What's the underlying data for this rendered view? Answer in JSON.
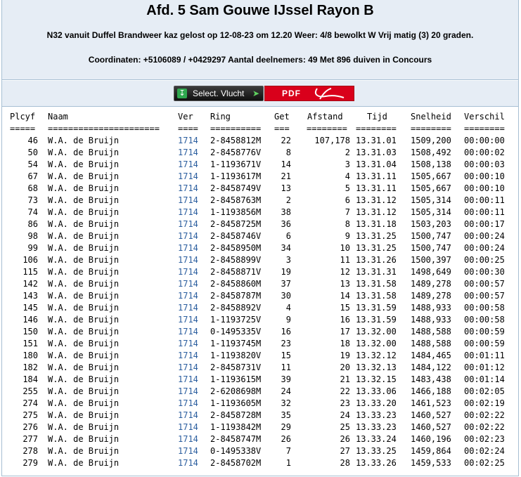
{
  "header": {
    "title": "Afd. 5 Sam Gouwe IJssel Rayon B",
    "line1": "N32 vanuit Duffel Brandweer kaz gelost op 12-08-23 om 12.20 Weer: 4/8 bewolkt W Vrij matig (3) 20 graden.",
    "line2": "Coordinaten: +5106089 / +0429297 Aantal deelnemers: 49 Met 896 duiven in Concours"
  },
  "toolbar": {
    "select_label": "Select. Vlucht",
    "pdf_label": "PDF"
  },
  "columns": {
    "plcyf": "Plcyf",
    "naam": "Naam",
    "ver": "Ver",
    "ring": "Ring",
    "get": "Get",
    "afstand": "Afstand",
    "tijd": "Tijd",
    "snelheid": "Snelheid",
    "verschil": "Verschil"
  },
  "separators": {
    "plcyf": "=====",
    "naam": "======================",
    "ver": "====",
    "ring": "==========",
    "get": "===",
    "afstand": "========",
    "tijd": "========",
    "snelheid": "========",
    "verschil": "========"
  },
  "rows": [
    {
      "plcyf": "46",
      "naam": "W.A. de Bruijn",
      "ver": "1714",
      "ring": "2-8458812M",
      "get": "22",
      "afstand": "107,178",
      "tijd": "13.31.01",
      "snelheid": "1509,200",
      "verschil": "00:00:00"
    },
    {
      "plcyf": "50",
      "naam": "W.A. de Bruijn",
      "ver": "1714",
      "ring": "2-8458776V",
      "get": "8",
      "afstand": "2",
      "tijd": "13.31.03",
      "snelheid": "1508,492",
      "verschil": "00:00:02"
    },
    {
      "plcyf": "54",
      "naam": "W.A. de Bruijn",
      "ver": "1714",
      "ring": "1-1193671V",
      "get": "14",
      "afstand": "3",
      "tijd": "13.31.04",
      "snelheid": "1508,138",
      "verschil": "00:00:03"
    },
    {
      "plcyf": "67",
      "naam": "W.A. de Bruijn",
      "ver": "1714",
      "ring": "1-1193617M",
      "get": "21",
      "afstand": "4",
      "tijd": "13.31.11",
      "snelheid": "1505,667",
      "verschil": "00:00:10"
    },
    {
      "plcyf": "68",
      "naam": "W.A. de Bruijn",
      "ver": "1714",
      "ring": "2-8458749V",
      "get": "13",
      "afstand": "5",
      "tijd": "13.31.11",
      "snelheid": "1505,667",
      "verschil": "00:00:10"
    },
    {
      "plcyf": "73",
      "naam": "W.A. de Bruijn",
      "ver": "1714",
      "ring": "2-8458763M",
      "get": "2",
      "afstand": "6",
      "tijd": "13.31.12",
      "snelheid": "1505,314",
      "verschil": "00:00:11"
    },
    {
      "plcyf": "74",
      "naam": "W.A. de Bruijn",
      "ver": "1714",
      "ring": "1-1193856M",
      "get": "38",
      "afstand": "7",
      "tijd": "13.31.12",
      "snelheid": "1505,314",
      "verschil": "00:00:11"
    },
    {
      "plcyf": "86",
      "naam": "W.A. de Bruijn",
      "ver": "1714",
      "ring": "2-8458725M",
      "get": "36",
      "afstand": "8",
      "tijd": "13.31.18",
      "snelheid": "1503,203",
      "verschil": "00:00:17"
    },
    {
      "plcyf": "98",
      "naam": "W.A. de Bruijn",
      "ver": "1714",
      "ring": "2-8458746V",
      "get": "6",
      "afstand": "9",
      "tijd": "13.31.25",
      "snelheid": "1500,747",
      "verschil": "00:00:24"
    },
    {
      "plcyf": "99",
      "naam": "W.A. de Bruijn",
      "ver": "1714",
      "ring": "2-8458950M",
      "get": "34",
      "afstand": "10",
      "tijd": "13.31.25",
      "snelheid": "1500,747",
      "verschil": "00:00:24"
    },
    {
      "plcyf": "106",
      "naam": "W.A. de Bruijn",
      "ver": "1714",
      "ring": "2-8458899V",
      "get": "3",
      "afstand": "11",
      "tijd": "13.31.26",
      "snelheid": "1500,397",
      "verschil": "00:00:25"
    },
    {
      "plcyf": "115",
      "naam": "W.A. de Bruijn",
      "ver": "1714",
      "ring": "2-8458871V",
      "get": "19",
      "afstand": "12",
      "tijd": "13.31.31",
      "snelheid": "1498,649",
      "verschil": "00:00:30"
    },
    {
      "plcyf": "142",
      "naam": "W.A. de Bruijn",
      "ver": "1714",
      "ring": "2-8458860M",
      "get": "37",
      "afstand": "13",
      "tijd": "13.31.58",
      "snelheid": "1489,278",
      "verschil": "00:00:57"
    },
    {
      "plcyf": "143",
      "naam": "W.A. de Bruijn",
      "ver": "1714",
      "ring": "2-8458787M",
      "get": "30",
      "afstand": "14",
      "tijd": "13.31.58",
      "snelheid": "1489,278",
      "verschil": "00:00:57"
    },
    {
      "plcyf": "145",
      "naam": "W.A. de Bruijn",
      "ver": "1714",
      "ring": "2-8458892V",
      "get": "4",
      "afstand": "15",
      "tijd": "13.31.59",
      "snelheid": "1488,933",
      "verschil": "00:00:58"
    },
    {
      "plcyf": "146",
      "naam": "W.A. de Bruijn",
      "ver": "1714",
      "ring": "1-1193725V",
      "get": "9",
      "afstand": "16",
      "tijd": "13.31.59",
      "snelheid": "1488,933",
      "verschil": "00:00:58"
    },
    {
      "plcyf": "150",
      "naam": "W.A. de Bruijn",
      "ver": "1714",
      "ring": "0-1495335V",
      "get": "16",
      "afstand": "17",
      "tijd": "13.32.00",
      "snelheid": "1488,588",
      "verschil": "00:00:59"
    },
    {
      "plcyf": "151",
      "naam": "W.A. de Bruijn",
      "ver": "1714",
      "ring": "1-1193745M",
      "get": "23",
      "afstand": "18",
      "tijd": "13.32.00",
      "snelheid": "1488,588",
      "verschil": "00:00:59"
    },
    {
      "plcyf": "180",
      "naam": "W.A. de Bruijn",
      "ver": "1714",
      "ring": "1-1193820V",
      "get": "15",
      "afstand": "19",
      "tijd": "13.32.12",
      "snelheid": "1484,465",
      "verschil": "00:01:11"
    },
    {
      "plcyf": "182",
      "naam": "W.A. de Bruijn",
      "ver": "1714",
      "ring": "2-8458731V",
      "get": "11",
      "afstand": "20",
      "tijd": "13.32.13",
      "snelheid": "1484,122",
      "verschil": "00:01:12"
    },
    {
      "plcyf": "184",
      "naam": "W.A. de Bruijn",
      "ver": "1714",
      "ring": "1-1193615M",
      "get": "39",
      "afstand": "21",
      "tijd": "13.32.15",
      "snelheid": "1483,438",
      "verschil": "00:01:14"
    },
    {
      "plcyf": "255",
      "naam": "W.A. de Bruijn",
      "ver": "1714",
      "ring": "2-6208698M",
      "get": "24",
      "afstand": "22",
      "tijd": "13.33.06",
      "snelheid": "1466,188",
      "verschil": "00:02:05"
    },
    {
      "plcyf": "274",
      "naam": "W.A. de Bruijn",
      "ver": "1714",
      "ring": "1-1193605M",
      "get": "32",
      "afstand": "23",
      "tijd": "13.33.20",
      "snelheid": "1461,523",
      "verschil": "00:02:19"
    },
    {
      "plcyf": "275",
      "naam": "W.A. de Bruijn",
      "ver": "1714",
      "ring": "2-8458728M",
      "get": "35",
      "afstand": "24",
      "tijd": "13.33.23",
      "snelheid": "1460,527",
      "verschil": "00:02:22"
    },
    {
      "plcyf": "276",
      "naam": "W.A. de Bruijn",
      "ver": "1714",
      "ring": "1-1193842M",
      "get": "29",
      "afstand": "25",
      "tijd": "13.33.23",
      "snelheid": "1460,527",
      "verschil": "00:02:22"
    },
    {
      "plcyf": "277",
      "naam": "W.A. de Bruijn",
      "ver": "1714",
      "ring": "2-8458747M",
      "get": "26",
      "afstand": "26",
      "tijd": "13.33.24",
      "snelheid": "1460,196",
      "verschil": "00:02:23"
    },
    {
      "plcyf": "278",
      "naam": "W.A. de Bruijn",
      "ver": "1714",
      "ring": "0-1495338V",
      "get": "7",
      "afstand": "27",
      "tijd": "13.33.25",
      "snelheid": "1459,864",
      "verschil": "00:02:24"
    },
    {
      "plcyf": "279",
      "naam": "W.A. de Bruijn",
      "ver": "1714",
      "ring": "2-8458702M",
      "get": "1",
      "afstand": "28",
      "tijd": "13.33.26",
      "snelheid": "1459,533",
      "verschil": "00:02:25"
    }
  ]
}
